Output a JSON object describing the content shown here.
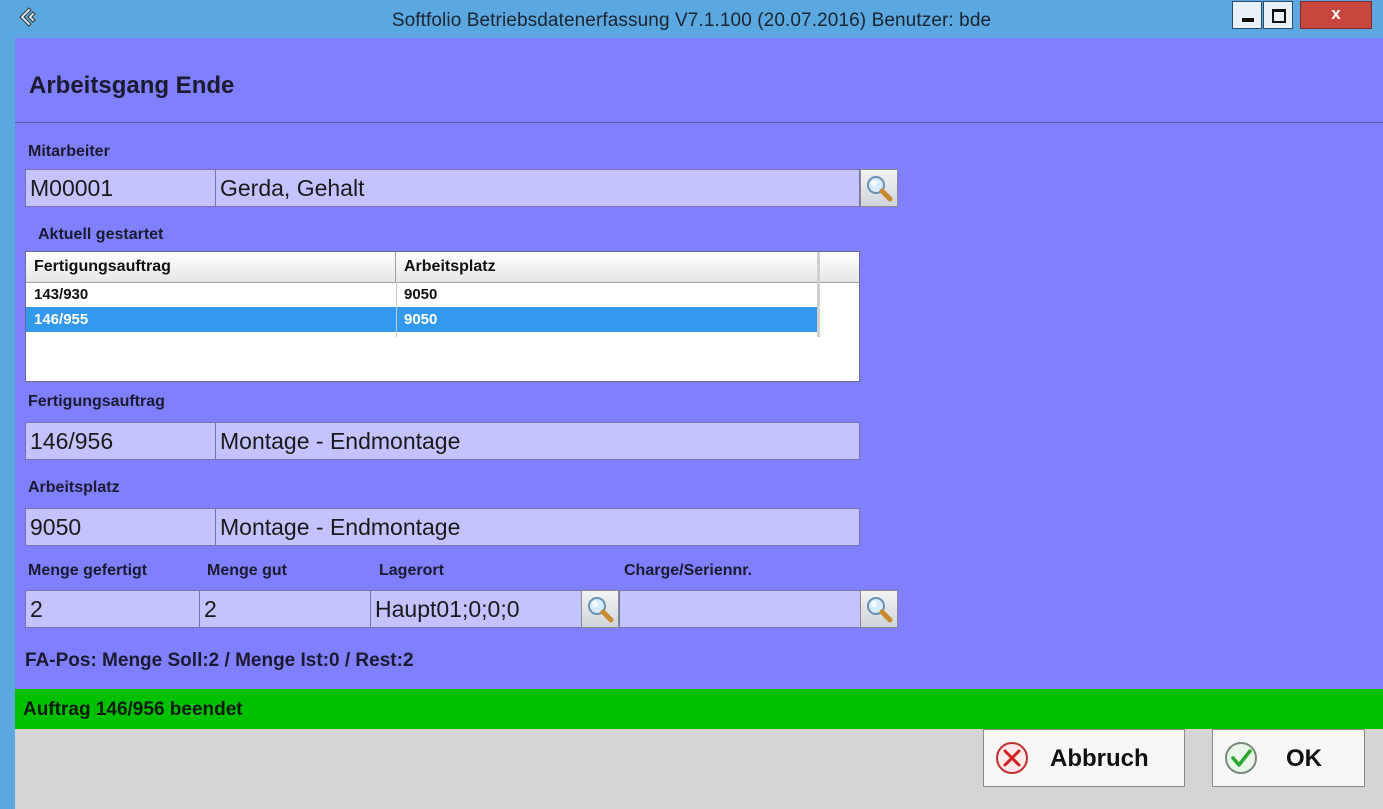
{
  "window": {
    "title": "Softfolio Betriebsdatenerfassung V7.1.100 (20.07.2016) Benutzer: bde",
    "close_glyph": "x"
  },
  "page": {
    "title": "Arbeitsgang Ende"
  },
  "mitarbeiter": {
    "label": "Mitarbeiter",
    "id": "M00001",
    "name": "Gerda, Gehalt"
  },
  "aktuell": {
    "label": "Aktuell gestartet",
    "columns": [
      "Fertigungsauftrag",
      "Arbeitsplatz"
    ],
    "rows": [
      {
        "auftrag": "143/930",
        "arbeitsplatz": "9050",
        "selected": false
      },
      {
        "auftrag": "146/955",
        "arbeitsplatz": "9050",
        "selected": true
      }
    ]
  },
  "fertigungsauftrag": {
    "label": "Fertigungsauftrag",
    "id": "146/956",
    "desc": "Montage - Endmontage"
  },
  "arbeitsplatz": {
    "label": "Arbeitsplatz",
    "id": "9050",
    "desc": "Montage - Endmontage"
  },
  "mengen": {
    "gefertigt_label": "Menge gefertigt",
    "gut_label": "Menge gut",
    "lagerort_label": "Lagerort",
    "charge_label": "Charge/Seriennr.",
    "gefertigt": "2",
    "gut": "2",
    "lagerort": "Haupt01;0;0;0",
    "charge": ""
  },
  "summary": "FA-Pos: Menge Soll:2 / Menge Ist:0 / Rest:2",
  "status": "Auftrag 146/956 beendet",
  "buttons": {
    "cancel": "Abbruch",
    "ok": "OK"
  },
  "colors": {
    "titlebar": "#5aa8df",
    "client": "#8080ff",
    "field": "#c3c3ff",
    "selection": "#3399ee",
    "status": "#00c000"
  }
}
